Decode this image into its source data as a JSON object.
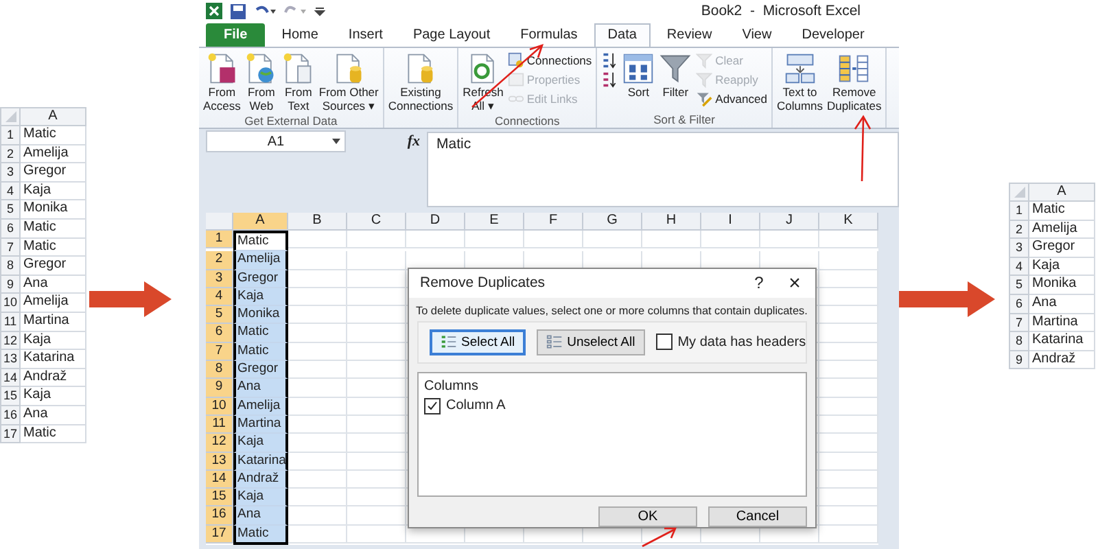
{
  "left_sheet": {
    "column": "A",
    "rows": [
      {
        "n": "1",
        "v": "Matic"
      },
      {
        "n": "2",
        "v": "Amelija"
      },
      {
        "n": "3",
        "v": "Gregor"
      },
      {
        "n": "4",
        "v": "Kaja"
      },
      {
        "n": "5",
        "v": "Monika"
      },
      {
        "n": "6",
        "v": "Matic"
      },
      {
        "n": "7",
        "v": "Matic"
      },
      {
        "n": "8",
        "v": "Gregor"
      },
      {
        "n": "9",
        "v": "Ana"
      },
      {
        "n": "10",
        "v": "Amelija"
      },
      {
        "n": "11",
        "v": "Martina"
      },
      {
        "n": "12",
        "v": "Kaja"
      },
      {
        "n": "13",
        "v": "Katarina"
      },
      {
        "n": "14",
        "v": "Andraž"
      },
      {
        "n": "15",
        "v": "Kaja"
      },
      {
        "n": "16",
        "v": "Ana"
      },
      {
        "n": "17",
        "v": "Matic"
      }
    ]
  },
  "excel": {
    "title": "Book2  -  Microsoft Excel",
    "tabs": [
      {
        "label": "File",
        "kind": "file",
        "selected": false
      },
      {
        "label": "Home",
        "kind": "tab",
        "selected": false
      },
      {
        "label": "Insert",
        "kind": "tab",
        "selected": false
      },
      {
        "label": "Page Layout",
        "kind": "tab",
        "selected": false
      },
      {
        "label": "Formulas",
        "kind": "tab",
        "selected": false
      },
      {
        "label": "Data",
        "kind": "tab",
        "selected": true
      },
      {
        "label": "Review",
        "kind": "tab",
        "selected": false
      },
      {
        "label": "View",
        "kind": "tab",
        "selected": false
      },
      {
        "label": "Developer",
        "kind": "tab",
        "selected": false
      }
    ],
    "ribbon_groups": [
      {
        "label": "Get External Data",
        "columns": [
          [
            {
              "kind": "large",
              "lines": [
                "From",
                "Access"
              ],
              "disabled": false
            }
          ],
          [
            {
              "kind": "large",
              "lines": [
                "From",
                "Web"
              ],
              "disabled": false
            }
          ],
          [
            {
              "kind": "large",
              "lines": [
                "From",
                "Text"
              ],
              "disabled": false
            }
          ],
          [
            {
              "kind": "large",
              "lines": [
                "From Other",
                "Sources ▾"
              ],
              "disabled": false
            }
          ]
        ]
      },
      {
        "columns": [
          [
            {
              "kind": "large",
              "lines": [
                "Existing",
                "Connections"
              ],
              "disabled": false
            }
          ]
        ]
      },
      {
        "label": "Connections",
        "columns": [
          [
            {
              "kind": "large",
              "lines": [
                "Refresh",
                "All ▾"
              ],
              "disabled": false
            }
          ],
          [
            {
              "kind": "small",
              "lines": [
                "Connections"
              ],
              "disabled": false
            },
            {
              "kind": "small",
              "lines": [
                "Properties"
              ],
              "disabled": true
            },
            {
              "kind": "small",
              "lines": [
                "Edit Links"
              ],
              "disabled": true
            }
          ]
        ]
      },
      {
        "label": "Sort & Filter",
        "columns": [
          [
            {
              "kind": "small",
              "disabled": false
            },
            {
              "kind": "small",
              "disabled": false
            }
          ],
          [
            {
              "kind": "large",
              "lines": [
                "Sort"
              ],
              "disabled": false
            }
          ],
          [
            {
              "kind": "large",
              "lines": [
                "Filter"
              ],
              "disabled": false
            }
          ],
          [
            {
              "kind": "small",
              "lines": [
                "Clear"
              ],
              "disabled": true
            },
            {
              "kind": "small",
              "lines": [
                "Reapply"
              ],
              "disabled": true
            },
            {
              "kind": "small",
              "lines": [
                "Advanced"
              ],
              "disabled": false
            }
          ]
        ]
      },
      {
        "columns": [
          [
            {
              "kind": "large",
              "lines": [
                "Text to",
                "Columns"
              ],
              "disabled": false
            }
          ],
          [
            {
              "kind": "large",
              "lines": [
                "Remove",
                "Duplicates"
              ],
              "disabled": false
            }
          ]
        ]
      }
    ],
    "name_box": "A1",
    "function_button": "fx",
    "formula": "Matic",
    "columns": [
      {
        "label": "A",
        "selected": true
      },
      {
        "label": "B",
        "selected": false
      },
      {
        "label": "C",
        "selected": false
      },
      {
        "label": "D",
        "selected": false
      },
      {
        "label": "E",
        "selected": false
      },
      {
        "label": "F",
        "selected": false
      },
      {
        "label": "G",
        "selected": false
      },
      {
        "label": "H",
        "selected": false
      },
      {
        "label": "I",
        "selected": false
      },
      {
        "label": "J",
        "selected": false
      },
      {
        "label": "K",
        "selected": false
      }
    ],
    "rows": [
      {
        "n": "1",
        "v": "Matic",
        "selected": true,
        "active": true
      },
      {
        "n": "2",
        "v": "Amelija",
        "selected": true,
        "active": false
      },
      {
        "n": "3",
        "v": "Gregor",
        "selected": true,
        "active": false
      },
      {
        "n": "4",
        "v": "Kaja",
        "selected": true,
        "active": false
      },
      {
        "n": "5",
        "v": "Monika",
        "selected": true,
        "active": false
      },
      {
        "n": "6",
        "v": "Matic",
        "selected": true,
        "active": false
      },
      {
        "n": "7",
        "v": "Matic",
        "selected": true,
        "active": false
      },
      {
        "n": "8",
        "v": "Gregor",
        "selected": true,
        "active": false
      },
      {
        "n": "9",
        "v": "Ana",
        "selected": true,
        "active": false
      },
      {
        "n": "10",
        "v": "Amelija",
        "selected": true,
        "active": false
      },
      {
        "n": "11",
        "v": "Martina",
        "selected": true,
        "active": false
      },
      {
        "n": "12",
        "v": "Kaja",
        "selected": true,
        "active": false
      },
      {
        "n": "13",
        "v": "Katarina",
        "selected": true,
        "active": false
      },
      {
        "n": "14",
        "v": "Andraž",
        "selected": true,
        "active": false
      },
      {
        "n": "15",
        "v": "Kaja",
        "selected": true,
        "active": false
      },
      {
        "n": "16",
        "v": "Ana",
        "selected": true,
        "active": false
      },
      {
        "n": "17",
        "v": "Matic",
        "selected": true,
        "active": false
      }
    ],
    "dialog": {
      "title": "Remove Duplicates",
      "help": "?",
      "close": "×",
      "instruction": "To delete duplicate values, select one or more columns that contain duplicates.",
      "buttons": [
        {
          "label": "Select All",
          "focused": true
        },
        {
          "label": "Unselect All",
          "focused": false
        }
      ],
      "headers_option": {
        "label": "My data has headers",
        "checked": false
      },
      "list_header": "Columns",
      "list_items": [
        {
          "label": "Column A",
          "checked": true
        }
      ],
      "actions": [
        {
          "label": "OK",
          "focused": false
        },
        {
          "label": "Cancel",
          "focused": false
        }
      ]
    }
  },
  "right_sheet": {
    "column": "A",
    "rows": [
      {
        "n": "1",
        "v": "Matic"
      },
      {
        "n": "2",
        "v": "Amelija"
      },
      {
        "n": "3",
        "v": "Gregor"
      },
      {
        "n": "4",
        "v": "Kaja"
      },
      {
        "n": "5",
        "v": "Monika"
      },
      {
        "n": "6",
        "v": "Ana"
      },
      {
        "n": "7",
        "v": "Martina"
      },
      {
        "n": "8",
        "v": "Katarina"
      },
      {
        "n": "9",
        "v": "Andraž"
      }
    ]
  }
}
